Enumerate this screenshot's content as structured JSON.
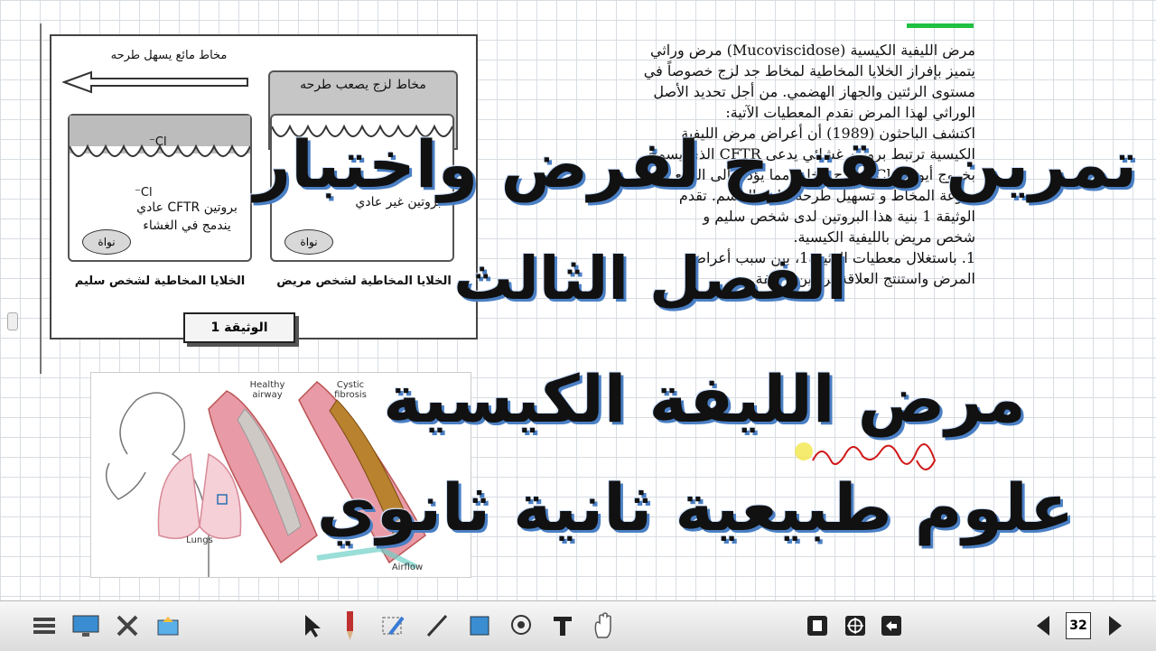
{
  "document": {
    "figure": {
      "healthy_arrow_label": "مخاط مائع يسهل طرحه",
      "sick_mucus_label": "مخاط لزج يصعب طرحه",
      "chloride_label": "Cl⁻",
      "healthy_protein_label": "بروتين CFTR عادي يندمج في الغشاء",
      "sick_protein_label": "بروتين غير عادي",
      "nucleus_label": "نواة",
      "healthy_cells_caption": "الخلايا المخاطية لشخص سليم",
      "sick_cells_caption": "الخلايا المخاطية لشخص مريض",
      "document_caption": "الوثيقة 1"
    },
    "text_lines": [
      "مرض الليفية الكيسية (Mucoviscidose) مرض وراثي",
      "يتميز بإفراز الخلايا المخاطية لمخاط جد لزج خصوصاً في",
      "مستوى الرئتين والجهاز الهضمي. من أجل تحديد الأصل",
      "الوراثي لهذا المرض نقدم المعطيات الآتية:",
      "اكتشف الباحثون (1989) أن أعراض مرض الليفية",
      "الكيسية ترتبط بروتين غشائي يدعى CFTR الذي يسمح",
      "بخروج أيونات Cl⁻ خارج الخلية مما يؤدي إلى الرفع من",
      "ميوعة المخاط و تسهيل طرحه خارج الجسم. تقدم",
      "الوثيقة 1 بنية هذا البروتين لدى شخص سليم و",
      "شخص مريض بالليفية الكيسية.",
      "1. باستغلال معطيات الوثيقة1، بين سبب أعراض",
      "المرض واستنتج العلاقة بروتين - صفة."
    ],
    "illustration": {
      "healthy_airway_label": "Healthy airway",
      "cystic_fibrosis_label": "Cystic fibrosis",
      "lungs_label": "Lungs",
      "airflow_label": "Airflow"
    }
  },
  "overlay": {
    "line1": "تمرين مقترح لفرض واختبار",
    "line2": "الفصل الثالث",
    "line3": "مرض الليفة الكيسية",
    "line4": "علوم طبيعية ثانية ثانوي"
  },
  "toolbar": {
    "page_number": "32",
    "tools": [
      "menu-icon",
      "display-icon",
      "tools-icon",
      "gallery-icon",
      "select-icon",
      "pen-icon",
      "eraser-icon",
      "line-icon",
      "shape-icon",
      "magic-ink-icon",
      "text-icon",
      "hand-icon",
      "delete-icon",
      "screen-shade-icon",
      "undo-icon",
      "previous-page-icon",
      "next-page-icon"
    ]
  },
  "colors": {
    "overlay_shadow": "#4a7fc4",
    "grid": "#d8dde3",
    "green_mark": "#20c040",
    "ink_red": "#d01818"
  }
}
